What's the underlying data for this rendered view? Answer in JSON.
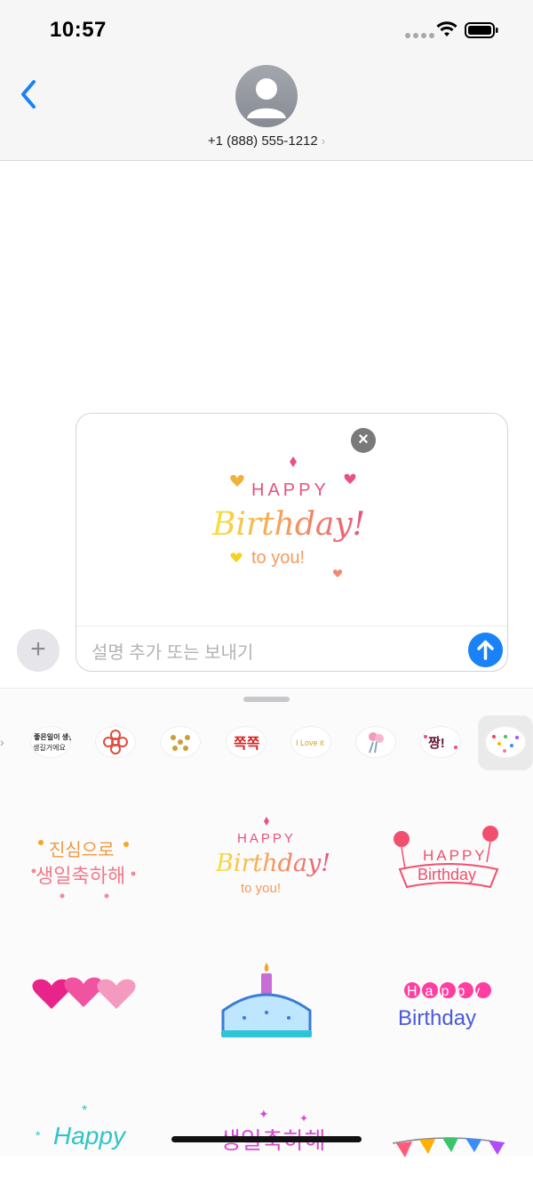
{
  "status": {
    "time": "10:57"
  },
  "header": {
    "contact": "+1 (888) 555-1212",
    "chevron": "›"
  },
  "compose": {
    "placeholder": "설명 추가 또는 보내기",
    "remove_glyph": "×",
    "plus_glyph": "+",
    "preview_sticker": {
      "line1": "HAPPY",
      "line2": "Birthday!",
      "line3": "to you!"
    }
  },
  "app_strip": {
    "items": [
      {
        "label": "좋은일이 생길거예요"
      },
      {
        "label": "flower"
      },
      {
        "label": "hearts"
      },
      {
        "label": "쪽쪽"
      },
      {
        "label": "I Love it"
      },
      {
        "label": "bouquet"
      },
      {
        "label": "짱!"
      },
      {
        "label": "Happy birthday colorful",
        "selected": true
      }
    ]
  },
  "stickers": [
    {
      "line1": "진심으로",
      "line2": "생일축하해"
    },
    {
      "line1": "HAPPY",
      "line2": "Birthday!",
      "line3": "to you!"
    },
    {
      "line1": "HAPPY",
      "line2": "Birthday"
    },
    {
      "line1": "three hearts"
    },
    {
      "line1": "birthday cake"
    },
    {
      "line1": "Happy",
      "line2": "Birthday"
    },
    {
      "line1": "Happy"
    },
    {
      "line1": "생일축하해"
    },
    {
      "line1": "bunting"
    }
  ],
  "colors": {
    "accent": "#1a82f7",
    "pink": "#e84f88",
    "yellow": "#f5d020"
  }
}
